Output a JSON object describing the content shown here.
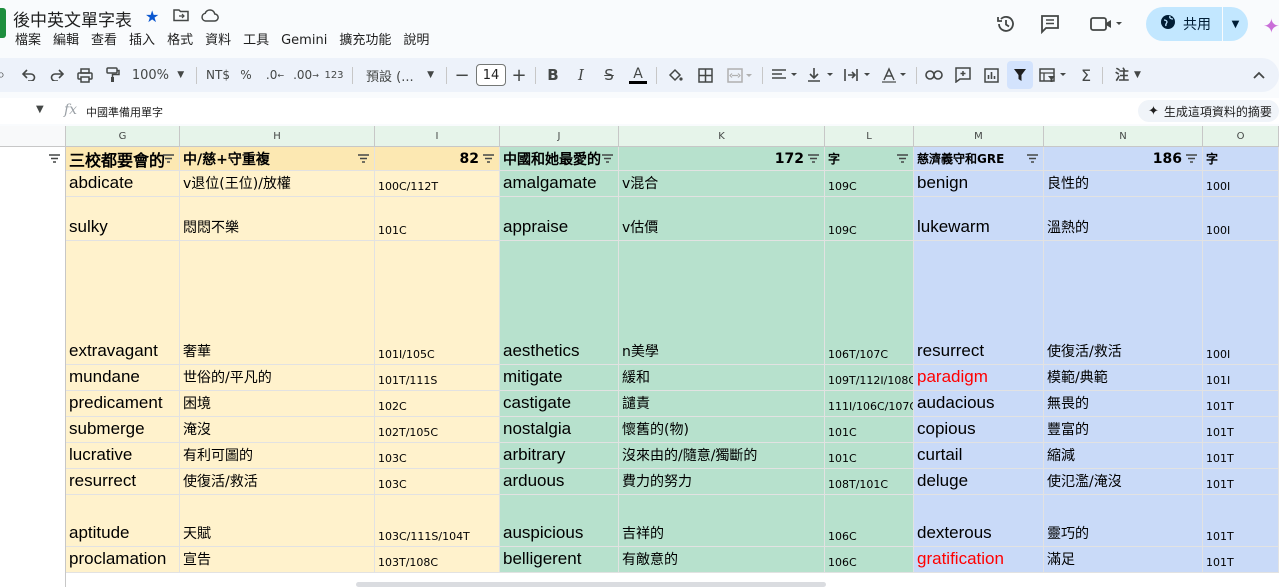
{
  "title": "後中英文單字表",
  "menu": [
    "檔案",
    "編輯",
    "查看",
    "插入",
    "格式",
    "資料",
    "工具",
    "Gemini",
    "擴充功能",
    "說明"
  ],
  "share_label": "共用",
  "toolbar": {
    "zoom": "100%",
    "currency": "NT$",
    "percent": "%",
    "dec_decrease": ".0",
    "dec_increase": ".00",
    "number_format": "123",
    "font_name": "預設 (...",
    "font_size": "14"
  },
  "formula": {
    "fx": "fx",
    "value": "中國準備用單字"
  },
  "summary_button": "生成這項資料的摘要",
  "colors": {
    "yellow": "#fff2cc",
    "green": "#b7e1cd",
    "blue": "#c9daf8",
    "header_yellow": "#fce8b2",
    "red_text": "#ff0000"
  },
  "columns": [
    "G",
    "H",
    "I",
    "J",
    "K",
    "L",
    "M",
    "N",
    "O"
  ],
  "header_row": {
    "g": "三校都要會的",
    "h": "中/慈+守重複",
    "i": "82",
    "j": "中國和她最愛的",
    "k": "172",
    "l": "字",
    "m": "慈濟義守和GRE",
    "n": "186",
    "o": "字"
  },
  "rows": [
    {
      "g": "abdicate",
      "h": "v退位(王位)/放權",
      "i": "100C/112T",
      "j": "amalgamate",
      "k": "v混合",
      "l": "109C",
      "m": "benign",
      "m_red": false,
      "n": "良性的",
      "o": "100I"
    },
    {
      "g": "sulky",
      "h": "悶悶不樂",
      "i": "101C",
      "j": "appraise",
      "k": "v估價",
      "l": "109C",
      "m": "lukewarm",
      "m_red": false,
      "n": "溫熱的",
      "o": "100I"
    },
    {
      "g": "extravagant",
      "h": "奢華",
      "i": "101I/105C",
      "j": "aesthetics",
      "k": "n美學",
      "l": "106T/107C",
      "m": "resurrect",
      "m_red": false,
      "n": "使復活/救活",
      "o": "100I"
    },
    {
      "g": "mundane",
      "h": "世俗的/平凡的",
      "i": "101T/111S",
      "j": "mitigate",
      "k": "緩和",
      "l": "109T/112I/108C",
      "m": "paradigm",
      "m_red": true,
      "n": "模範/典範",
      "o": "101I"
    },
    {
      "g": "predicament",
      "h": "困境",
      "i": "102C",
      "j": "castigate",
      "k": "譴責",
      "l": "111I/106C/107C",
      "m": "audacious",
      "m_red": false,
      "n": "無畏的",
      "o": "101T"
    },
    {
      "g": "submerge",
      "h": "淹沒",
      "i": "102T/105C",
      "j": "nostalgia",
      "k": "懷舊的(物)",
      "l": "101C",
      "m": "copious",
      "m_red": false,
      "n": "豐富的",
      "o": "101T"
    },
    {
      "g": "lucrative",
      "h": "有利可圖的",
      "i": "103C",
      "j": "arbitrary",
      "k": "沒來由的/隨意/獨斷的",
      "l": "101C",
      "m": "curtail",
      "m_red": false,
      "n": "縮減",
      "o": "101T"
    },
    {
      "g": "resurrect",
      "h": "使復活/救活",
      "i": "103C",
      "j": "arduous",
      "k": "費力的努力",
      "l": "108T/101C",
      "m": "deluge",
      "m_red": false,
      "n": "使氾濫/淹沒",
      "o": "101T"
    },
    {
      "g": "aptitude",
      "h": "天賦",
      "i": "103C/111S/104T",
      "j": "auspicious",
      "k": "吉祥的",
      "l": "106C",
      "m": "dexterous",
      "m_red": false,
      "n": "靈巧的",
      "o": "101T"
    },
    {
      "g": "proclamation",
      "h": "宣告",
      "i": "103T/108C",
      "j": "belligerent",
      "k": "有敵意的",
      "l": "106C",
      "m": "gratification",
      "m_red": true,
      "n": "滿足",
      "o": "101T"
    }
  ]
}
